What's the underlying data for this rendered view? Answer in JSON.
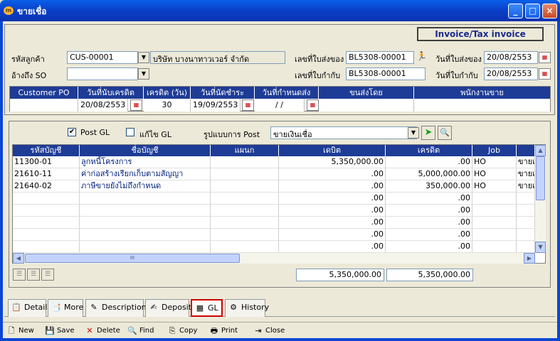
{
  "window": {
    "title": "ขายเชื่อ",
    "icon": "app-coin-icon",
    "controls": [
      "_",
      "□",
      "×"
    ]
  },
  "header": {
    "invoice_title": "Invoice/Tax invoice",
    "customer_code_label": "รหัสลูกค้า",
    "customer_code_value": "CUS-00001",
    "customer_name_value": "บริษัท บางนาทาวเวอร์ จำกัด",
    "ref_so_label": "อ้างถึง SO",
    "ref_so_value": "",
    "delivery_no_label": "เลขที่ใบส่งของ",
    "delivery_no_value": "BL5308-00001",
    "delivery_date_label": "วันที่ใบส่งของ",
    "delivery_date_value": "20/08/2553",
    "tax_no_label": "เลขที่ใบกำกับ",
    "tax_no_value": "BL5308-00001",
    "tax_date_label": "วันที่ใบกำกับ",
    "tax_date_value": "20/08/2553"
  },
  "credit_table": {
    "headers": [
      "Customer PO",
      "วันที่นับเครดิต",
      "เครดิต (วัน)",
      "วันที่นัดชำระ",
      "วันที่กำหนดส่ง",
      "ขนส่งโดย",
      "พนักงานขาย"
    ],
    "values": [
      "",
      "20/08/2553",
      "30",
      "19/09/2553",
      " /  /",
      "",
      ""
    ]
  },
  "gl": {
    "post_gl_label": "Post GL",
    "post_gl_checked": "✔",
    "edit_gl_label": "แก้ไข GL",
    "post_format_label": "รูปแบบการ Post",
    "post_format_value": "ขายเงินเชื่อ",
    "columns": [
      "รหัสบัญชี",
      "ชื่อบัญชี",
      "แผนก",
      "เดบิต",
      "เครดิต",
      "Job",
      ""
    ],
    "rows": [
      [
        "11300-01",
        "ลูกหนี้โครงการ",
        "",
        "5,350,000.00",
        ".00",
        "HO",
        "ขายเ"
      ],
      [
        "21610-11",
        "ค่าก่อสร้างเรียกเก็บตามสัญญา",
        "",
        ".00",
        "5,000,000.00",
        "HO",
        "ขายเ"
      ],
      [
        "21640-02",
        "ภาษีขายยังไม่ถึงกำหนด",
        "",
        ".00",
        "350,000.00",
        "HO",
        "ขายเ"
      ],
      [
        "",
        "",
        "",
        ".00",
        ".00",
        "",
        ""
      ],
      [
        "",
        "",
        "",
        ".00",
        ".00",
        "",
        ""
      ],
      [
        "",
        "",
        "",
        ".00",
        ".00",
        "",
        ""
      ],
      [
        "",
        "",
        "",
        ".00",
        ".00",
        "",
        ""
      ],
      [
        "",
        "",
        "",
        ".00",
        ".00",
        "",
        ""
      ]
    ],
    "total_debit": "5,350,000.00",
    "total_credit": "5,350,000.00",
    "scroll_thumb_label": "III"
  },
  "tabs": [
    {
      "label": "Detail",
      "icon": "detail-icon"
    },
    {
      "label": "More",
      "icon": "more-icon"
    },
    {
      "label": "Description",
      "icon": "description-icon"
    },
    {
      "label": "Deposit",
      "icon": "deposit-icon"
    },
    {
      "label": "GL",
      "icon": "gl-icon"
    },
    {
      "label": "History",
      "icon": "history-icon"
    }
  ],
  "toolbar": {
    "new": "New",
    "save": "Save",
    "delete": "Delete",
    "find": "Find",
    "copy": "Copy",
    "print": "Print",
    "close": "Close"
  },
  "colors": {
    "title_bar": "#0A46D6",
    "header_blue": "#1E3C96",
    "active_tab_border": "#D00000"
  }
}
